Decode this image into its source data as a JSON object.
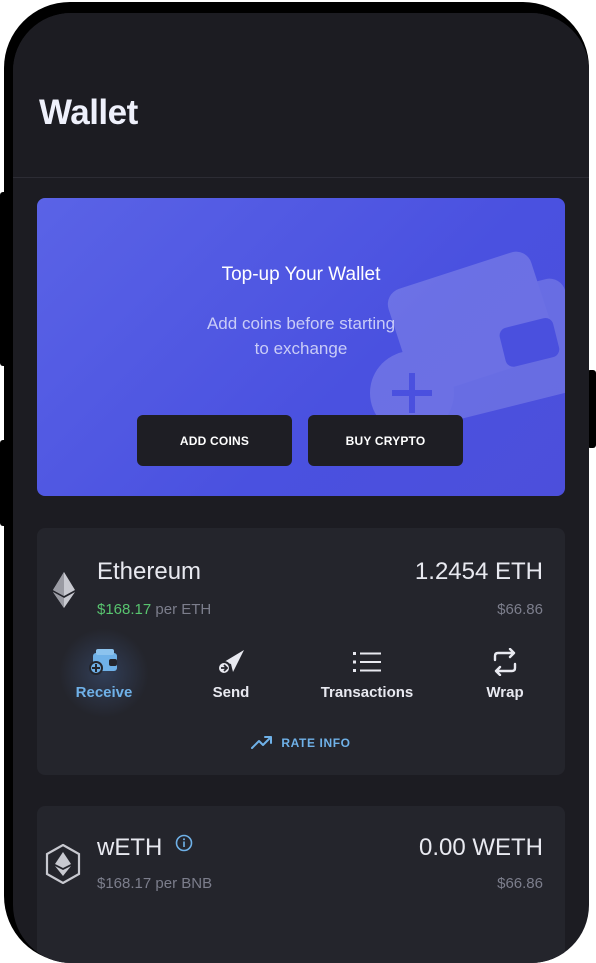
{
  "header": {
    "title": "Wallet"
  },
  "banner": {
    "title": "Top-up Your Wallet",
    "subtitle_line1": "Add coins before starting",
    "subtitle_line2": "to exchange",
    "add_coins_label": "ADD COINS",
    "buy_crypto_label": "BUY CRYPTO"
  },
  "coins": [
    {
      "name": "Ethereum",
      "amount": "1.2454 ETH",
      "rate_value": "$168.17",
      "rate_suffix": " per ETH",
      "fiat": "$66.86",
      "icon": "ethereum-icon"
    },
    {
      "name": "wETH",
      "amount": "0.00 WETH",
      "rate_value": "$168.17",
      "rate_suffix": " per BNB",
      "fiat": "$66.86",
      "icon": "weth-icon"
    }
  ],
  "actions": [
    {
      "label": "Receive",
      "icon": "wallet-receive-icon",
      "active": true
    },
    {
      "label": "Send",
      "icon": "send-icon",
      "active": false
    },
    {
      "label": "Transactions",
      "icon": "list-icon",
      "active": false
    },
    {
      "label": "Wrap",
      "icon": "swap-arrows-icon",
      "active": false
    }
  ],
  "rate_info_label": "RATE INFO",
  "colors": {
    "background": "#1c1c22",
    "card": "#24252c",
    "accent": "#4a51e0",
    "link": "#6fb1e8",
    "positive": "#58c46f"
  }
}
